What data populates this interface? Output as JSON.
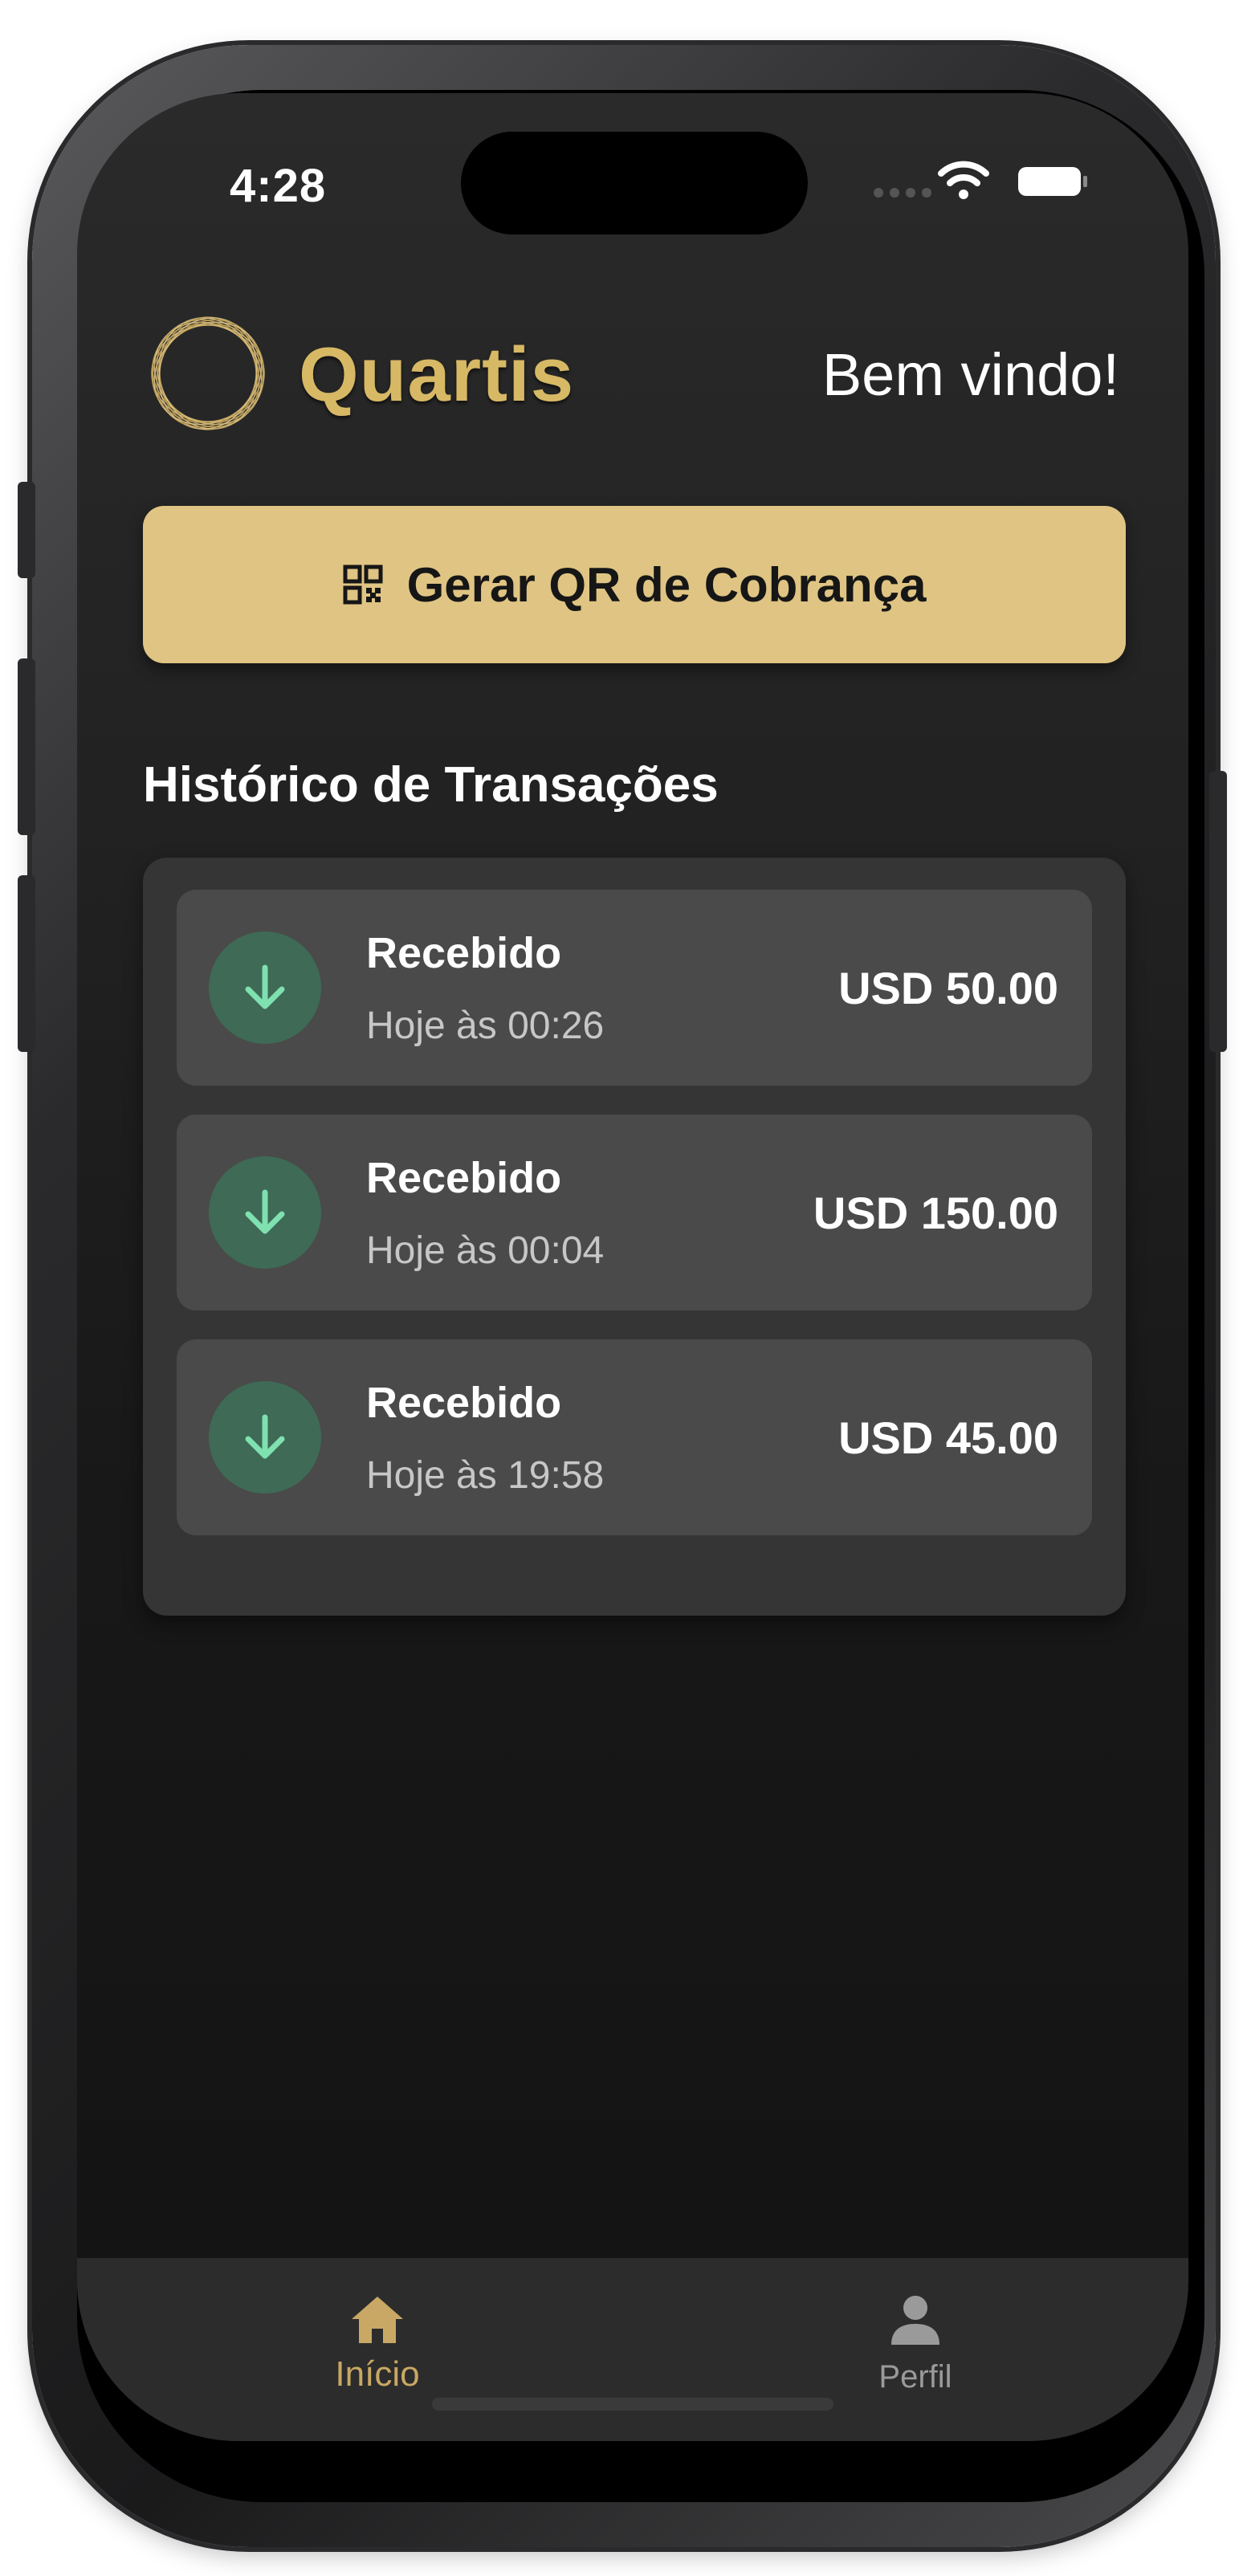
{
  "status_bar": {
    "time": "4:28",
    "icons": [
      "signal-dots-icon",
      "wifi-icon",
      "battery-icon"
    ]
  },
  "header": {
    "brand": "Quartis",
    "welcome": "Bem vindo!",
    "logo_icon": "spirograph-ring-logo"
  },
  "actions": {
    "generate_qr_label": "Gerar QR de Cobrança",
    "generate_qr_icon": "qr-code-icon"
  },
  "history": {
    "title": "Histórico de Transações",
    "items": [
      {
        "type": "Recebido",
        "time": "Hoje às 00:26",
        "amount": "USD 50.00",
        "icon": "arrow-down-icon"
      },
      {
        "type": "Recebido",
        "time": "Hoje às 00:04",
        "amount": "USD 150.00",
        "icon": "arrow-down-icon"
      },
      {
        "type": "Recebido",
        "time": "Hoje às 19:58",
        "amount": "USD 45.00",
        "icon": "arrow-down-icon"
      }
    ]
  },
  "tab_bar": {
    "tabs": [
      {
        "label": "Início",
        "icon": "home-icon",
        "active": true
      },
      {
        "label": "Perfil",
        "icon": "user-icon",
        "active": false
      }
    ]
  },
  "colors": {
    "accent_gold": "#dfc483",
    "brand_gold": "#d7b865",
    "received_icon_bg": "#3e6a56",
    "received_arrow": "#7fe0b0",
    "background": "#1c1c1c"
  }
}
